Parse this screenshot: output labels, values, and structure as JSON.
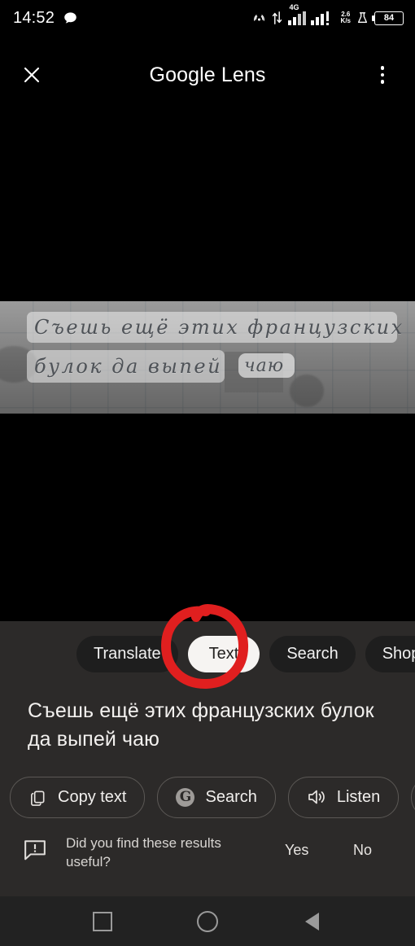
{
  "status_bar": {
    "clock": "14:52",
    "network_speed_value": "2.6",
    "network_speed_unit": "K/s",
    "mobile_network": "4G",
    "battery_level": "84",
    "icons": [
      "chat-bubble-icon",
      "cast-icon",
      "data-transfer-icon",
      "signal-bars-icon",
      "alarm-flask-icon",
      "battery-icon"
    ]
  },
  "app_bar": {
    "close_label": "✕",
    "title_part_one": "Google",
    "title_part_two": "Lens",
    "overflow_label": "more-options"
  },
  "viewfinder": {
    "handwriting_line_one": "Съешь  ещё  этих  французских",
    "handwriting_line_two": "булок  да  выпей",
    "handwriting_word_highlighted": "чаю"
  },
  "mode_chips": [
    {
      "label": "Translate",
      "selected": false
    },
    {
      "label": "Text",
      "selected": true
    },
    {
      "label": "Search",
      "selected": false
    },
    {
      "label": "Shopping",
      "selected": false
    }
  ],
  "annotation": {
    "shape": "hand-drawn-circle",
    "color": "#e01f1f",
    "target": "Text"
  },
  "result": {
    "recognized_text": "Съешь ещё этих французских булок да выпей чаю"
  },
  "action_chips": [
    {
      "label": "Copy text",
      "icon": "copy-icon"
    },
    {
      "label": "Search",
      "icon": "google-g-icon"
    },
    {
      "label": "Listen",
      "icon": "speaker-icon"
    },
    {
      "label": "",
      "icon": "google-translate-icon"
    }
  ],
  "feedback": {
    "icon": "feedback-bubble-icon",
    "question": "Did you find these results useful?",
    "yes_label": "Yes",
    "no_label": "No"
  },
  "nav_bar": {
    "recents_label": "recents",
    "home_label": "home",
    "back_label": "back"
  },
  "colors": {
    "background": "#000000",
    "sheet": "#2c2a29",
    "chip": "#1e1e1e",
    "chip_selected": "#f6f4f2",
    "annotation_red": "#e01f1f",
    "nav_bar": "#222222"
  }
}
